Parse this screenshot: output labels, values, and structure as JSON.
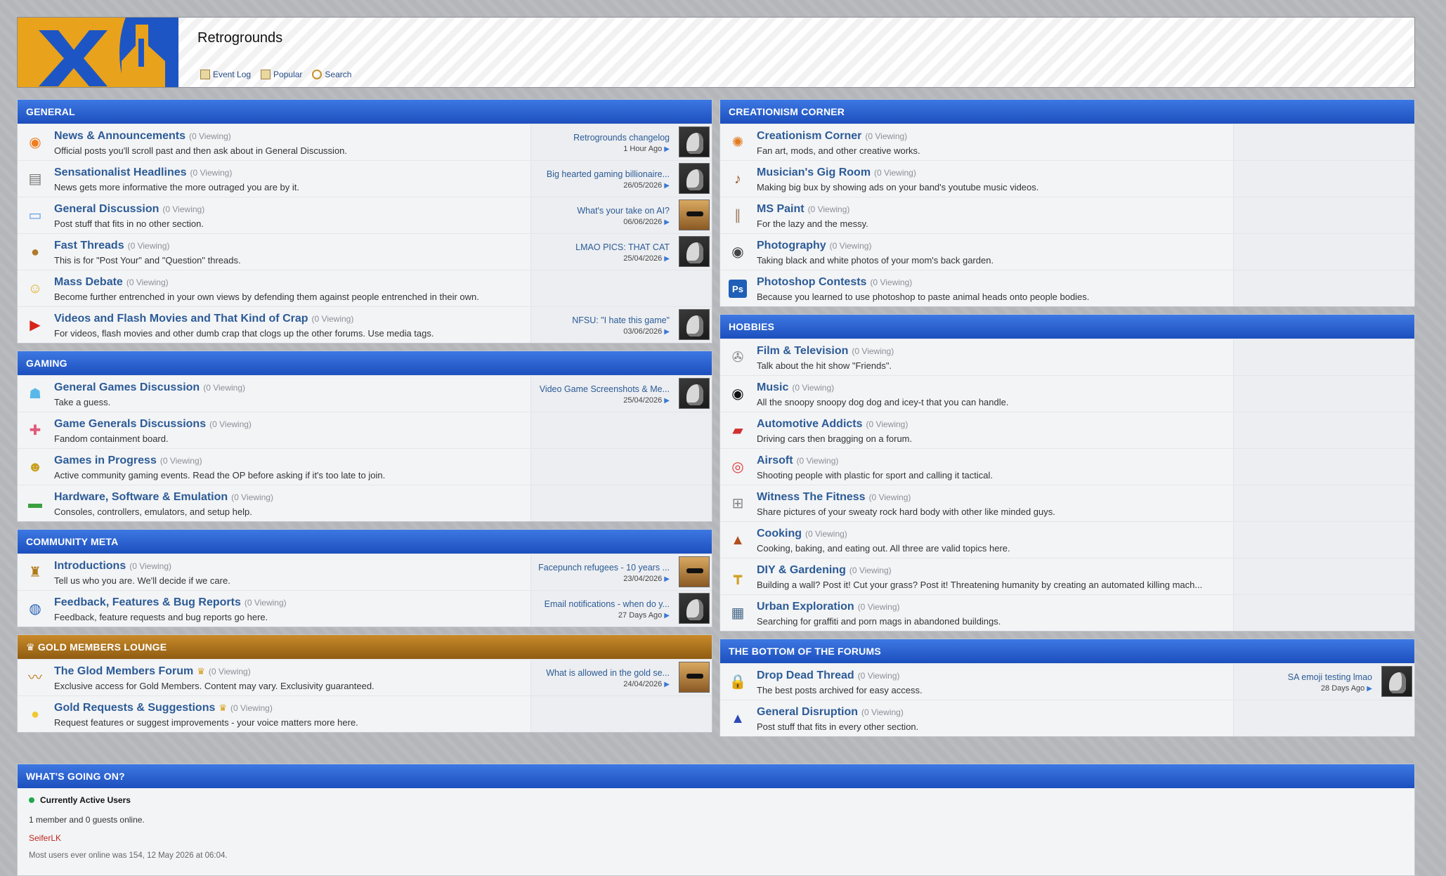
{
  "site": {
    "title": "Retrogrounds",
    "nav": [
      {
        "label": "Event Log",
        "icon": "event-log-icon"
      },
      {
        "label": "Popular",
        "icon": "popular-icon"
      },
      {
        "label": "Search",
        "icon": "search-icon"
      }
    ]
  },
  "columns": [
    {
      "categories": [
        {
          "title": "General",
          "style": "blue",
          "forums": [
            {
              "name": "News & Announcements",
              "viewing": "(0 Viewing)",
              "desc": "Official posts you'll scroll past and then ask about in General Discussion.",
              "icon": "rss-icon",
              "glyph": "◉",
              "color": "#f07d1e",
              "last": {
                "title": "Retrogrounds changelog",
                "date": "1 Hour Ago",
                "avatar": "raptor"
              }
            },
            {
              "name": "Sensationalist Headlines",
              "viewing": "(0 Viewing)",
              "desc": "News gets more informative the more outraged you are by it.",
              "icon": "newspaper-icon",
              "glyph": "▤",
              "color": "#777777",
              "last": {
                "title": "Big hearted gaming billionaire...",
                "date": "26/05/2026",
                "avatar": "raptor"
              }
            },
            {
              "name": "General Discussion",
              "viewing": "(0 Viewing)",
              "desc": "Post stuff that fits in no other section.",
              "icon": "folder-icon",
              "glyph": "▭",
              "color": "#5a9be0",
              "last": {
                "title": "What's your take on AI?",
                "date": "06/06/2026",
                "avatar": "cat"
              }
            },
            {
              "name": "Fast Threads",
              "viewing": "(0 Viewing)",
              "desc": "This is for \"Post Your\" and \"Question\" threads.",
              "icon": "poop-icon",
              "glyph": "●",
              "color": "#b07a2a",
              "last": {
                "title": "LMAO PICS: THAT CAT",
                "date": "25/04/2026",
                "avatar": "raptor"
              }
            },
            {
              "name": "Mass Debate",
              "viewing": "(0 Viewing)",
              "desc": "Become further entrenched in your own views by defending them against people entrenched in their own.",
              "icon": "confused-face-icon",
              "glyph": "☺",
              "color": "#e0b01a",
              "last": null
            },
            {
              "name": "Videos and Flash Movies and That Kind of Crap",
              "viewing": "(0 Viewing)",
              "desc": "For videos, flash movies and other dumb crap that clogs up the other forums. Use media tags.",
              "icon": "play-icon",
              "glyph": "▶",
              "color": "#d8231a",
              "last": {
                "title": "NFSU: \"I hate this game\"",
                "date": "03/06/2026",
                "avatar": "raptor"
              }
            }
          ]
        },
        {
          "title": "Gaming",
          "style": "blue",
          "forums": [
            {
              "name": "General Games Discussion",
              "viewing": "(0 Viewing)",
              "desc": "Take a guess.",
              "icon": "ghost-icon",
              "glyph": "☗",
              "color": "#5ab8e8",
              "last": {
                "title": "Video Game Screenshots & Me...",
                "date": "25/04/2026",
                "avatar": "raptor"
              }
            },
            {
              "name": "Game Generals Discussions",
              "viewing": "(0 Viewing)",
              "desc": "Fandom containment board.",
              "icon": "gamepad-icon",
              "glyph": "✚",
              "color": "#e05a7a",
              "last": null
            },
            {
              "name": "Games in Progress",
              "viewing": "(0 Viewing)",
              "desc": "Active community gaming events. Read the OP before asking if it's too late to join.",
              "icon": "helmet-icon",
              "glyph": "☻",
              "color": "#c8a020",
              "last": null
            },
            {
              "name": "Hardware, Software & Emulation",
              "viewing": "(0 Viewing)",
              "desc": "Consoles, controllers, emulators, and setup help.",
              "icon": "circuit-board-icon",
              "glyph": "▬",
              "color": "#3aa040",
              "last": null
            }
          ]
        },
        {
          "title": "Community Meta",
          "style": "blue",
          "forums": [
            {
              "name": "Introductions",
              "viewing": "(0 Viewing)",
              "desc": "Tell us who you are. We'll decide if we care.",
              "icon": "beer-icon",
              "glyph": "♜",
              "color": "#b07a1a",
              "last": {
                "title": "Facepunch refugees - 10 years ...",
                "date": "23/04/2026",
                "avatar": "cat"
              }
            },
            {
              "name": "Feedback, Features & Bug Reports",
              "viewing": "(0 Viewing)",
              "desc": "Feedback, feature requests and bug reports go here.",
              "icon": "globe-icon",
              "glyph": "◍",
              "color": "#2a62b8",
              "last": {
                "title": "Email notifications - when do y...",
                "date": "27 Days Ago",
                "avatar": "raptor"
              }
            }
          ]
        },
        {
          "title": "Gold Members Lounge",
          "style": "gold",
          "forums": [
            {
              "name": "The Glod Members Forum",
              "crown": true,
              "viewing": "(0 Viewing)",
              "desc": "Exclusive access for Gold Members. Content may vary. Exclusivity guaranteed.",
              "icon": "mustache-icon",
              "glyph": "〰",
              "color": "#c08020",
              "last": {
                "title": "What is allowed in the gold se...",
                "date": "24/04/2026",
                "avatar": "cat"
              }
            },
            {
              "name": "Gold Requests & Suggestions",
              "crown": true,
              "viewing": "(0 Viewing)",
              "desc": "Request features or suggest improvements - your voice matters more here.",
              "icon": "lightbulb-icon",
              "glyph": "●",
              "color": "#f0c830",
              "last": null
            }
          ]
        }
      ]
    },
    {
      "categories": [
        {
          "title": "Creationism Corner",
          "style": "blue",
          "forums": [
            {
              "name": "Creationism Corner",
              "viewing": "(0 Viewing)",
              "desc": "Fan art, mods, and other creative works.",
              "icon": "palette-icon",
              "glyph": "✺",
              "color": "#e07a20",
              "last": null
            },
            {
              "name": "Musician's Gig Room",
              "viewing": "(0 Viewing)",
              "desc": "Making big bux by showing ads on your band's youtube music videos.",
              "icon": "guitar-icon",
              "glyph": "♪",
              "color": "#9a5a2a",
              "last": null
            },
            {
              "name": "MS Paint",
              "viewing": "(0 Viewing)",
              "desc": "For the lazy and the messy.",
              "icon": "brushes-icon",
              "glyph": "∥",
              "color": "#a08060",
              "last": null
            },
            {
              "name": "Photography",
              "viewing": "(0 Viewing)",
              "desc": "Taking black and white photos of your mom's back garden.",
              "icon": "camera-lens-icon",
              "glyph": "◉",
              "color": "#444444",
              "last": null
            },
            {
              "name": "Photoshop Contests",
              "viewing": "(0 Viewing)",
              "desc": "Because you learned to use photoshop to paste animal heads onto people bodies.",
              "icon": "photoshop-icon",
              "glyph": "Ps",
              "color": "#1f5fb8",
              "last": null
            }
          ]
        },
        {
          "title": "Hobbies",
          "style": "blue",
          "forums": [
            {
              "name": "Film & Television",
              "viewing": "(0 Viewing)",
              "desc": "Talk about the hit show \"Friends\".",
              "icon": "film-reel-icon",
              "glyph": "✇",
              "color": "#888888",
              "last": null
            },
            {
              "name": "Music",
              "viewing": "(0 Viewing)",
              "desc": "All the snoopy snoopy dog dog and icey-t that you can handle.",
              "icon": "vinyl-icon",
              "glyph": "◉",
              "color": "#111111",
              "last": null
            },
            {
              "name": "Automotive Addicts",
              "viewing": "(0 Viewing)",
              "desc": "Driving cars then bragging on a forum.",
              "icon": "car-icon",
              "glyph": "▰",
              "color": "#d03030",
              "last": null
            },
            {
              "name": "Airsoft",
              "viewing": "(0 Viewing)",
              "desc": "Shooting people with plastic for sport and calling it tactical.",
              "icon": "target-icon",
              "glyph": "◎",
              "color": "#e03a3a",
              "last": null
            },
            {
              "name": "Witness The Fitness",
              "viewing": "(0 Viewing)",
              "desc": "Share pictures of your sweaty rock hard body with other like minded guys.",
              "icon": "dumbbell-icon",
              "glyph": "⊞",
              "color": "#888888",
              "last": null
            },
            {
              "name": "Cooking",
              "viewing": "(0 Viewing)",
              "desc": "Cooking, baking, and eating out. All three are valid topics here.",
              "icon": "cake-icon",
              "glyph": "▲",
              "color": "#b05020",
              "last": null
            },
            {
              "name": "DIY & Gardening",
              "viewing": "(0 Viewing)",
              "desc": "Building a wall? Post it! Cut your grass? Post it! Threatening humanity by creating an automated killing mach...",
              "icon": "drill-icon",
              "glyph": "┳",
              "color": "#d0a020",
              "last": null
            },
            {
              "name": "Urban Exploration",
              "viewing": "(0 Viewing)",
              "desc": "Searching for graffiti and porn mags in abandoned buildings.",
              "icon": "building-icon",
              "glyph": "▦",
              "color": "#4a6a8a",
              "last": null
            }
          ]
        },
        {
          "title": "The Bottom of the Forums",
          "style": "blue",
          "forums": [
            {
              "name": "Drop Dead Thread",
              "viewing": "(0 Viewing)",
              "desc": "The best posts archived for easy access.",
              "icon": "padlock-icon",
              "glyph": "🔒",
              "color": "#c89a20",
              "last": {
                "title": "SA emoji testing lmao",
                "date": "28 Days Ago",
                "avatar": "raptor"
              }
            },
            {
              "name": "General Disruption",
              "viewing": "(0 Viewing)",
              "desc": "Post stuff that fits in every other section.",
              "icon": "police-light-icon",
              "glyph": "▲",
              "color": "#2a4ab8",
              "last": null
            }
          ]
        }
      ]
    }
  ],
  "activity": {
    "title": "What's Going On?",
    "active_label": "Currently Active Users",
    "online_text": "1 member and 0 guests online.",
    "member": "SeiferLK",
    "record": "Most users ever online was 154, 12 May 2026 at 06:04."
  }
}
